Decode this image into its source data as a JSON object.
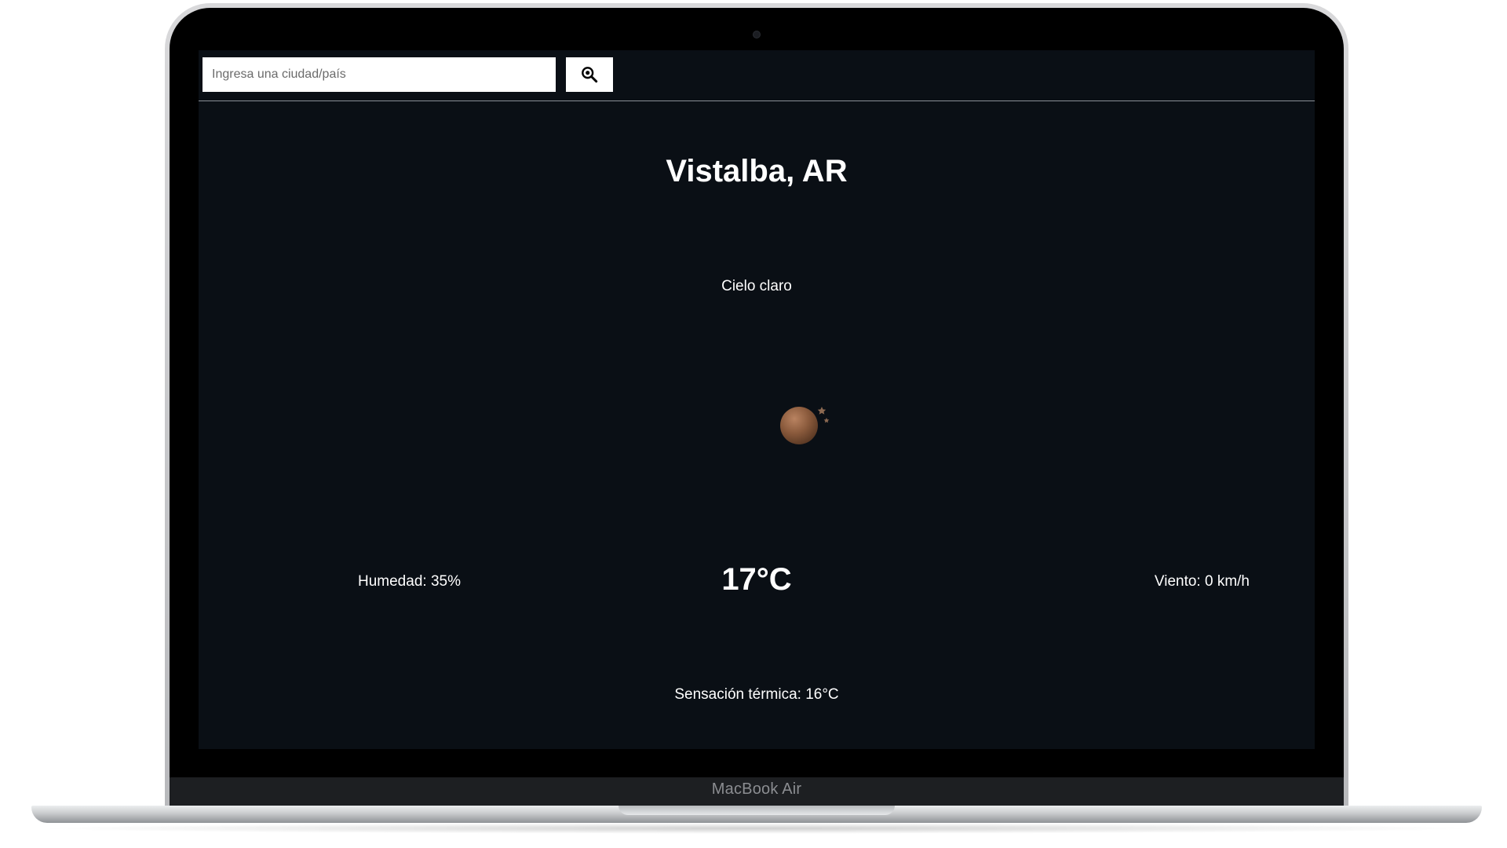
{
  "search": {
    "placeholder": "Ingresa una ciudad/país",
    "value": "",
    "button_icon": "magnifier-icon"
  },
  "weather": {
    "city": "Vistalba, AR",
    "description": "Cielo claro",
    "icon": "clear-night-moon-icon",
    "humidity": "Humedad: 35%",
    "temperature": "17°C",
    "wind": "Viento: 0 km/h",
    "feels_like": "Sensación térmica: 16°C"
  },
  "device": {
    "label": "MacBook Air"
  },
  "colors": {
    "background": "#0a0f15",
    "text": "#ffffff",
    "moon": "#8a5a3c"
  }
}
